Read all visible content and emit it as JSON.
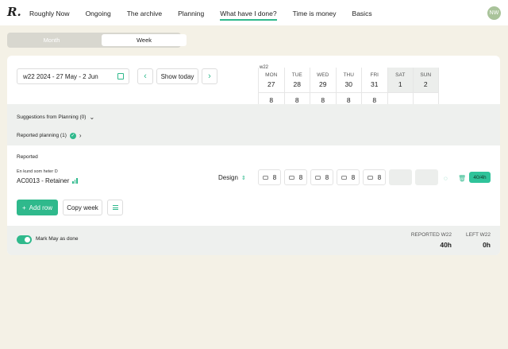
{
  "nav": {
    "logo": "R.",
    "items": [
      "Roughly Now",
      "Ongoing",
      "The archive",
      "Planning",
      "What have I done?",
      "Time is money",
      "Basics"
    ],
    "active": "What have I done?",
    "avatar_initials": "NW"
  },
  "view_toggle": {
    "month": "Month",
    "week": "Week",
    "selected": "Week"
  },
  "toolbar": {
    "date_range": "w22 2024 - 27 May - 2 Jun",
    "calendar_icon": "calendar-icon",
    "prev_icon": "chevron-left-icon",
    "next_icon": "chevron-right-icon",
    "show_today": "Show today"
  },
  "week": {
    "label": "w22",
    "days": [
      {
        "name": "MON",
        "date": "27",
        "hours": "8",
        "weekend": false
      },
      {
        "name": "TUE",
        "date": "28",
        "hours": "8",
        "weekend": false
      },
      {
        "name": "WED",
        "date": "29",
        "hours": "8",
        "weekend": false
      },
      {
        "name": "THU",
        "date": "30",
        "hours": "8",
        "weekend": false
      },
      {
        "name": "FRI",
        "date": "31",
        "hours": "8",
        "weekend": false
      },
      {
        "name": "SAT",
        "date": "1",
        "hours": "",
        "weekend": true
      },
      {
        "name": "SUN",
        "date": "2",
        "hours": "",
        "weekend": true
      }
    ]
  },
  "suggestions": {
    "label": "Suggestions from Planning (0)"
  },
  "reported_planning": {
    "label": "Reported planning (1)"
  },
  "reported": {
    "title": "Reported",
    "row": {
      "client": "En kund som heter D",
      "project": "AC0013 - Retainer",
      "activity": "Design",
      "hours": [
        "8",
        "8",
        "8",
        "8",
        "8",
        "",
        ""
      ],
      "badge": "40/4h"
    }
  },
  "actions": {
    "add_row": "Add row",
    "copy_week": "Copy week"
  },
  "footer": {
    "mark_done": "Mark May as done",
    "mark_done_on": true,
    "reported_label": "REPORTED W22",
    "reported_value": "40h",
    "left_label": "LEFT W22",
    "left_value": "0h"
  },
  "colors": {
    "accent": "#2fb98c",
    "background": "#f4f1e6"
  }
}
